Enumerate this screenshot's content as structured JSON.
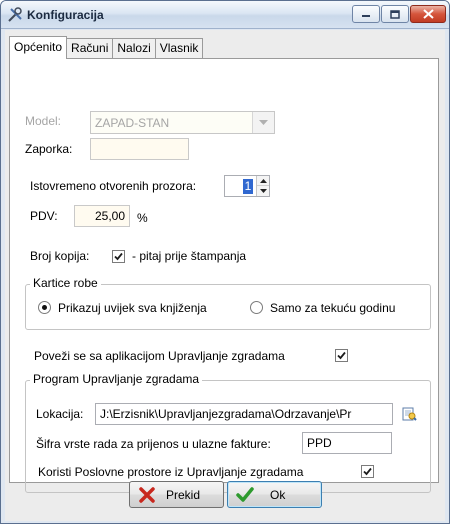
{
  "window": {
    "title": "Konfiguracija"
  },
  "tabs": [
    {
      "label": "Općenito",
      "active": true
    },
    {
      "label": "Računi",
      "active": false
    },
    {
      "label": "Nalozi",
      "active": false
    },
    {
      "label": "Vlasnik",
      "active": false
    }
  ],
  "general": {
    "model_label": "Model:",
    "model_value": "ZAPAD-STAN",
    "password_label": "Zaporka:",
    "password_value": "",
    "windows_label": "Istovremeno otvorenih prozora:",
    "windows_value": "1",
    "vat_label": "PDV:",
    "vat_value": "25,00",
    "vat_unit": "%",
    "copies_label": "Broj kopija:",
    "copies_check_label": "- pitaj prije štampanja",
    "copies_checked": true
  },
  "item_cards": {
    "title": "Kartice robe",
    "options": [
      {
        "label": "Prikazuj uvijek sva knjiženja",
        "selected": true
      },
      {
        "label": "Samo za tekuću godinu",
        "selected": false
      }
    ]
  },
  "connect": {
    "label": "Poveži se sa aplikacijom Upravljanje zgradama",
    "checked": true
  },
  "program": {
    "title": "Program Upravljanje zgradama",
    "location_label": "Lokacija:",
    "location_value": "J:\\Erzisnik\\Upravljanjezgradama\\Odrzavanje\\Pr",
    "work_code_label": "Šifra vrste rada za prijenos u ulazne fakture:",
    "work_code_value": "PPD",
    "use_premises_label": "Koristi Poslovne prostore iz Upravljanje zgradama",
    "use_premises_checked": true
  },
  "buttons": {
    "cancel": "Prekid",
    "ok": "Ok"
  },
  "colors": {
    "cancel_icon": "#c8281e",
    "ok_icon": "#2e9a2e",
    "selection": "#3068d0"
  }
}
